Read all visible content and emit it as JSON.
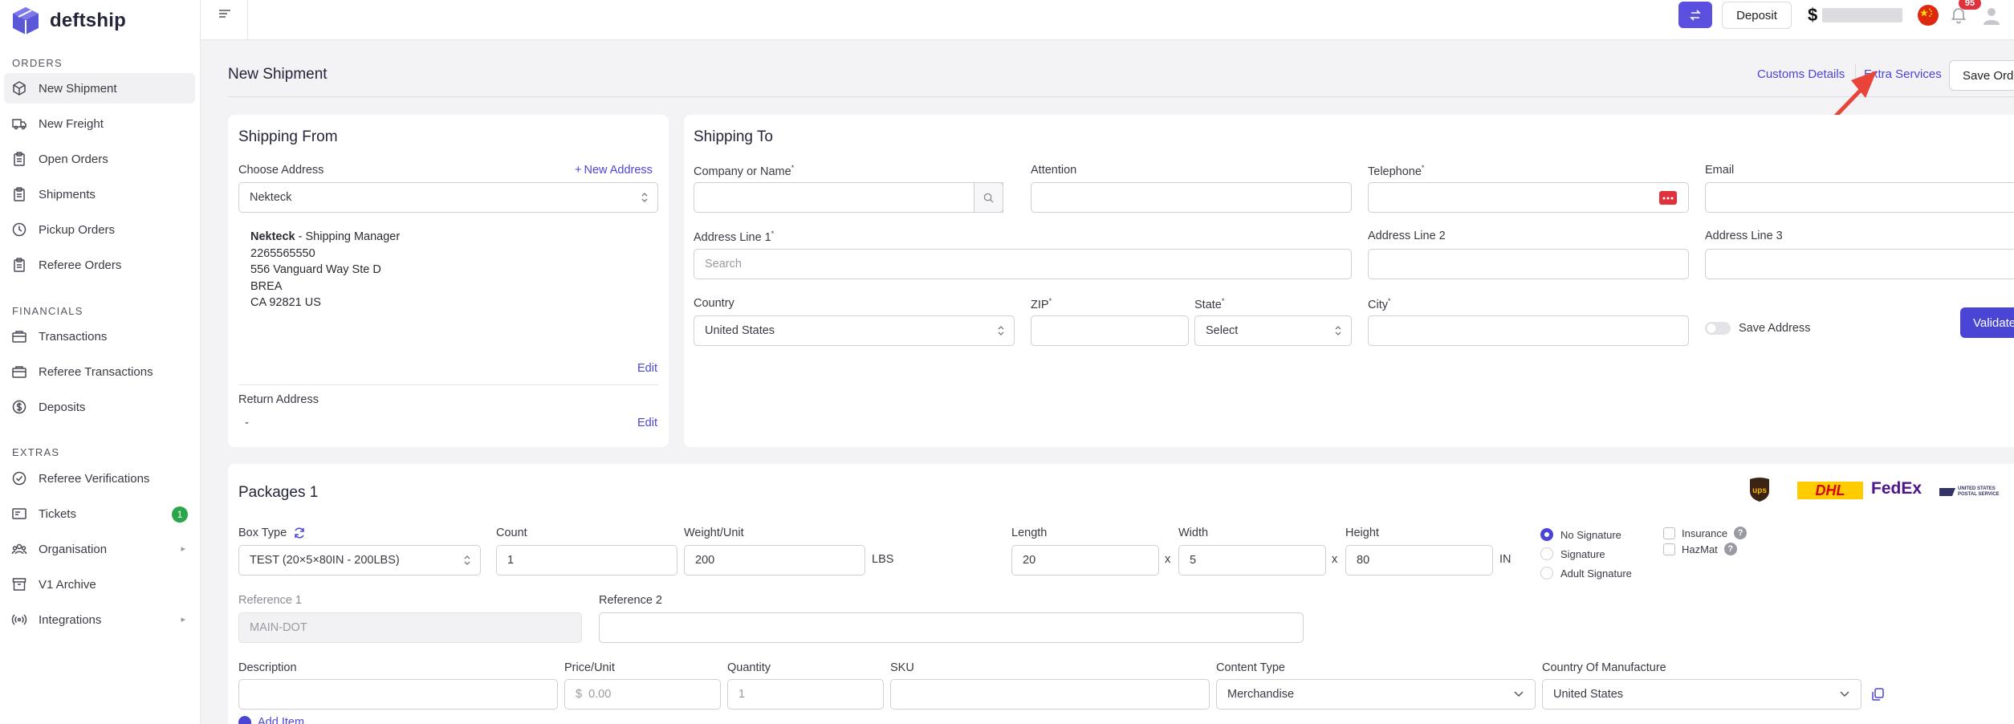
{
  "app": {
    "name": "deftship"
  },
  "sidebar": {
    "sections": [
      {
        "title": "ORDERS",
        "items": [
          {
            "label": "New Shipment",
            "icon": "box-icon",
            "active": true
          },
          {
            "label": "New Freight",
            "icon": "truck-icon"
          },
          {
            "label": "Open Orders",
            "icon": "clipboard-icon"
          },
          {
            "label": "Shipments",
            "icon": "clipboard-icon"
          },
          {
            "label": "Pickup Orders",
            "icon": "clock-icon"
          },
          {
            "label": "Referee Orders",
            "icon": "clipboard-icon"
          }
        ]
      },
      {
        "title": "FINANCIALS",
        "items": [
          {
            "label": "Transactions",
            "icon": "wallet-icon"
          },
          {
            "label": "Referee Transactions",
            "icon": "wallet-icon"
          },
          {
            "label": "Deposits",
            "icon": "dollar-icon"
          }
        ]
      },
      {
        "title": "EXTRAS",
        "items": [
          {
            "label": "Referee Verifications",
            "icon": "check-circle-icon"
          },
          {
            "label": "Tickets",
            "icon": "ticket-icon",
            "badge": "1"
          },
          {
            "label": "Organisation",
            "icon": "users-icon",
            "arrow": "▸"
          },
          {
            "label": "V1 Archive",
            "icon": "archive-icon"
          },
          {
            "label": "Integrations",
            "icon": "broadcast-icon",
            "arrow": "▸"
          }
        ]
      }
    ]
  },
  "topbar": {
    "deposit_label": "Deposit",
    "currency_symbol": "$",
    "notification_count": "95"
  },
  "header": {
    "title": "New Shipment",
    "customs_link": "Customs Details",
    "extras_link": "Extra Services",
    "save_label": "Save Order"
  },
  "shipping_from": {
    "title": "Shipping From",
    "choose_label": "Choose Address",
    "new_address_label": "New Address",
    "selected": "Nekteck",
    "address": {
      "name": "Nekteck",
      "role": " - Shipping Manager",
      "phone": "2265565550",
      "line1": "556 Vanguard Way Ste D",
      "city": "BREA",
      "region": "CA 92821 US"
    },
    "edit_label": "Edit",
    "return_label": "Return Address",
    "return_value": "-",
    "return_edit_label": "Edit"
  },
  "shipping_to": {
    "title": "Shipping To",
    "company_label": "Company or Name",
    "attention_label": "Attention",
    "telephone_label": "Telephone",
    "email_label": "Email",
    "addr1_label": "Address Line 1",
    "addr1_placeholder": "Search",
    "addr2_label": "Address Line 2",
    "addr3_label": "Address Line 3",
    "country_label": "Country",
    "country_value": "United States",
    "zip_label": "ZIP",
    "state_label": "State",
    "state_value": "Select",
    "city_label": "City",
    "save_address_label": "Save Address",
    "validate_label": "Validate",
    "required_mark": "*"
  },
  "packages": {
    "title": "Packages 1",
    "carriers": [
      "ups",
      "DHL",
      "FedEx",
      "UNITED STATES POSTAL SERVICE"
    ],
    "box_type_label": "Box Type",
    "box_type_value": "TEST (20×5×80IN - 200LBS)",
    "count_label": "Count",
    "count_value": "1",
    "weight_label": "Weight/Unit",
    "weight_value": "200",
    "weight_unit": "LBS",
    "length_label": "Length",
    "length_value": "20",
    "width_label": "Width",
    "width_value": "5",
    "height_label": "Height",
    "height_value": "80",
    "dim_unit": "IN",
    "times": "x",
    "signature_options": [
      "No Signature",
      "Signature",
      "Adult Signature"
    ],
    "insurance_label": "Insurance",
    "hazmat_label": "HazMat",
    "help_mark": "?",
    "ref1_label": "Reference 1",
    "ref1_value": "MAIN-DOT",
    "ref2_label": "Reference 2",
    "description_label": "Description",
    "price_label": "Price/Unit",
    "price_currency": "$",
    "price_placeholder": "0.00",
    "quantity_label": "Quantity",
    "quantity_placeholder": "1",
    "sku_label": "SKU",
    "content_type_label": "Content Type",
    "content_type_value": "Merchandise",
    "manufacture_label": "Country Of Manufacture",
    "manufacture_value": "United States",
    "add_item_label": "Add Item"
  },
  "colors": {
    "accent": "#4b45d6",
    "brand": "#5b4fe0",
    "badge_green": "#2aa64a",
    "alert_red": "#e0323c"
  }
}
